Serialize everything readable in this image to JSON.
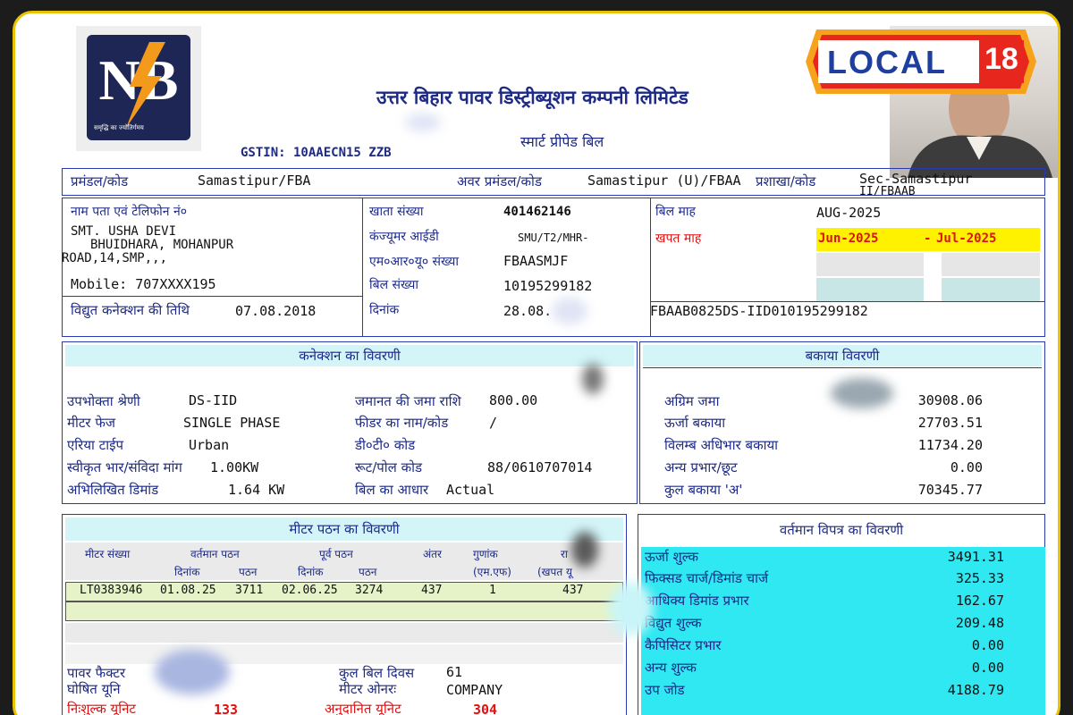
{
  "company": {
    "name": "उत्तर बिहार पावर डिस्ट्रीब्यूशन कम्पनी लिमिटेड",
    "subtitle": "स्मार्ट प्रीपेड बिल",
    "gstin": "GSTIN: 10AAECN15   ZZB",
    "logo_text": "NB",
    "logo_tagline": "समृद्धि का ज्योतिर्गमय"
  },
  "overlay": {
    "brand": "LOCAL",
    "brand_number": "18"
  },
  "header_row": {
    "division_label": "प्रमंडल/कोड",
    "division_value": "Samastipur/FBA",
    "subdivision_label": "अवर प्रमंडल/कोड",
    "subdivision_value": "Samastipur (U)/FBAA",
    "branch_label": "प्रशाखा/कोड",
    "branch_value": "Sec-Samastipur",
    "branch_value2": "II/FBAAB"
  },
  "consumer": {
    "name_label": "नाम पता एवं टेलिफोन नं०",
    "name": "SMT. USHA DEVI",
    "address1": "BHUIDHARA,  MOHANPUR",
    "address2": "ROAD,14,SMP,,,",
    "mobile": "Mobile: 707XXXX195",
    "connection_date_label": "विद्युत कनेक्शन की तिथि",
    "connection_date": "07.08.2018"
  },
  "account": {
    "account_no_label": "खाता संख्या",
    "account_no": "401462146",
    "consumer_id_label": "कंज्यूमर आईडी",
    "consumer_id": "SMU/T2/MHR-",
    "mru_label": "एम०आर०यू० संख्या",
    "mru": "FBAASMJF",
    "bill_no_label": "बिल संख्या",
    "bill_no": "10195299182",
    "date_label": "दिनांक",
    "date": "28.08."
  },
  "bill": {
    "month_label": "बिल माह",
    "month": "AUG-2025",
    "consumption_label": "खपत माह",
    "from": "Jun-2025",
    "dash": "-",
    "to": "Jul-2025",
    "bill_ref": "FBAAB0825DS-IID010195299182"
  },
  "connection_details": {
    "title": "कनेक्शन का विवरणी",
    "category_label": "उपभोक्ता श्रेणी",
    "category": "DS-IID",
    "phase_label": "मीटर फेज",
    "phase": "SINGLE PHASE",
    "area_label": "एरिया टाईप",
    "area": "Urban",
    "load_label": "स्वीकृत भार/संविदा मांग",
    "load": "1.00KW",
    "demand_label": "अभिलिखित डिमांड",
    "demand": "1.64 KW",
    "security_label": "जमानत की जमा राशि",
    "security": "800.00",
    "feeder_label": "फीडर का नाम/कोड",
    "feeder": "/",
    "dt_label": "डी०टी० कोड",
    "dt": "",
    "route_label": "रूट/पोल कोड",
    "route": "88/0610707014",
    "basis_label": "बिल का आधार",
    "basis": "Actual"
  },
  "arrears": {
    "title": "बकाया विवरणी",
    "rows": [
      {
        "label": "अग्रिम जमा",
        "value": "30908.06"
      },
      {
        "label": "ऊर्जा बकाया",
        "value": "27703.51"
      },
      {
        "label": "विलम्ब अधिभार बकाया",
        "value": "11734.20"
      },
      {
        "label": "अन्य प्रभार/छूट",
        "value": "0.00"
      },
      {
        "label": "कुल बकाया 'अ'",
        "value": "70345.77"
      }
    ]
  },
  "meter": {
    "title": "मीटर पठन का विवरणी",
    "col_meter": "मीटर संख्या",
    "col_current": "वर्तमान पठन",
    "col_previous": "पूर्व पठन",
    "col_diff": "अंतर",
    "col_mf": "गुणांक",
    "col_mf2": "(एम.एफ)",
    "col_cons": "रा",
    "col_cons2": "(खपत यू",
    "sub_date": "दिनांक",
    "sub_reading": "पठन",
    "row": {
      "meter_no": "LT0383946",
      "cur_date": "01.08.25",
      "cur_read": "3711",
      "prev_date": "02.06.25",
      "prev_read": "3274",
      "diff": "437",
      "mf": "1",
      "units": "437"
    },
    "pf_label": "पावर फैक्टर",
    "declared_label": "घोषित यूनि",
    "free_label": "निःशुल्क यूनिट",
    "free_value": "133",
    "days_label": "कुल बिल दिवस",
    "days_value": "61",
    "owner_label": "मीटर ओनरः",
    "owner_value": "COMPANY",
    "subsidised_label": "अनुदानित यूनिट",
    "subsidised_value": "304"
  },
  "current_bill": {
    "title": "वर्तमान विपत्र का विवरणी",
    "rows": [
      {
        "label": "ऊर्जा शुल्क",
        "value": "3491.31"
      },
      {
        "label": "फिक्सड चार्ज/डिमांड चार्ज",
        "value": "325.33"
      },
      {
        "label": "आधिक्य डिमांड प्रभार",
        "value": "162.67"
      },
      {
        "label": "विद्युत शुल्क",
        "value": "209.48"
      },
      {
        "label": "कैपिसिटर प्रभार",
        "value": "0.00"
      },
      {
        "label": "अन्य शुल्क",
        "value": "0.00"
      },
      {
        "label": "उप जोड",
        "value": "4188.79"
      }
    ]
  },
  "colors": {
    "navy": "#1d2a86",
    "border": "#2b39b0",
    "cyan": "#2fe8f2",
    "light_cyan": "#d3f5f8",
    "yellow": "#fff200",
    "green": "#e6f3c8",
    "red": "#e01010",
    "frame": "#e8c400"
  }
}
